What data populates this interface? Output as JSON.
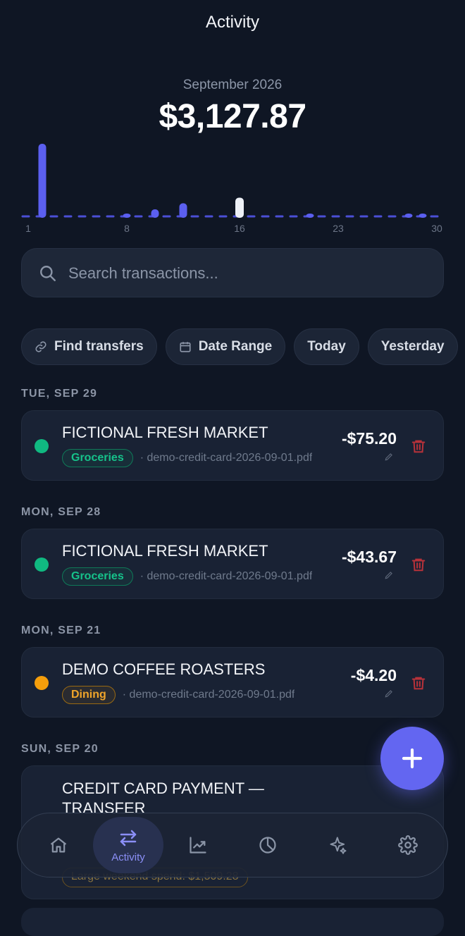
{
  "header": {
    "title": "Activity"
  },
  "summary": {
    "month": "September 2026",
    "total": "$3,127.87"
  },
  "chart_data": {
    "type": "bar",
    "x_tick_labels": [
      "1",
      "8",
      "16",
      "23",
      "30"
    ],
    "days": [
      1,
      2,
      3,
      4,
      5,
      6,
      7,
      8,
      9,
      10,
      11,
      12,
      13,
      14,
      15,
      16,
      17,
      18,
      19,
      20,
      21,
      22,
      23,
      24,
      25,
      26,
      27,
      28,
      29,
      30
    ],
    "values": [
      0,
      1400,
      0,
      0,
      0,
      0,
      0,
      75,
      0,
      160,
      0,
      275,
      0,
      0,
      0,
      380,
      0,
      0,
      0,
      0,
      4,
      0,
      0,
      0,
      0,
      0,
      0,
      44,
      75,
      0
    ],
    "highlight_day": 16,
    "colors": {
      "bar": "#5b5ff0",
      "highlight": "#eef1f7",
      "baseline": "#4b4fd6"
    }
  },
  "search": {
    "placeholder": "Search transactions..."
  },
  "filters": [
    {
      "label": "Find transfers",
      "icon": "link-icon"
    },
    {
      "label": "Date Range",
      "icon": "calendar-icon"
    },
    {
      "label": "Today"
    },
    {
      "label": "Yesterday"
    }
  ],
  "groups": [
    {
      "date": "TUE, SEP 29",
      "tx": {
        "merchant": "FICTIONAL FRESH MARKET",
        "category": "Groceries",
        "source": "· demo-credit-card-2026-09-01.pdf",
        "amount": "-$75.20"
      }
    },
    {
      "date": "MON, SEP 28",
      "tx": {
        "merchant": "FICTIONAL FRESH MARKET",
        "category": "Groceries",
        "source": "· demo-credit-card-2026-09-01.pdf",
        "amount": "-$43.67"
      }
    },
    {
      "date": "MON, SEP 21",
      "tx": {
        "merchant": "DEMO COFFEE ROASTERS",
        "category": "Dining",
        "source": "· demo-credit-card-2026-09-01.pdf",
        "amount": "-$4.20"
      }
    },
    {
      "date": "SUN, SEP 20",
      "tx": {
        "merchant": "CREDIT CARD PAYMENT — TRANSFER",
        "note": "Large weekend spend: $1,509.28"
      }
    }
  ],
  "colors": {
    "groceries": "#10b981",
    "dining": "#f59e0b",
    "accent": "#6366f1",
    "delete": "#b8323a"
  },
  "nav": [
    {
      "icon": "home-icon"
    },
    {
      "icon": "transfer-arrows-icon",
      "label": "Activity",
      "active": true
    },
    {
      "icon": "trend-chart-icon"
    },
    {
      "icon": "pie-chart-icon"
    },
    {
      "icon": "sparkle-icon"
    },
    {
      "icon": "gear-icon"
    }
  ]
}
